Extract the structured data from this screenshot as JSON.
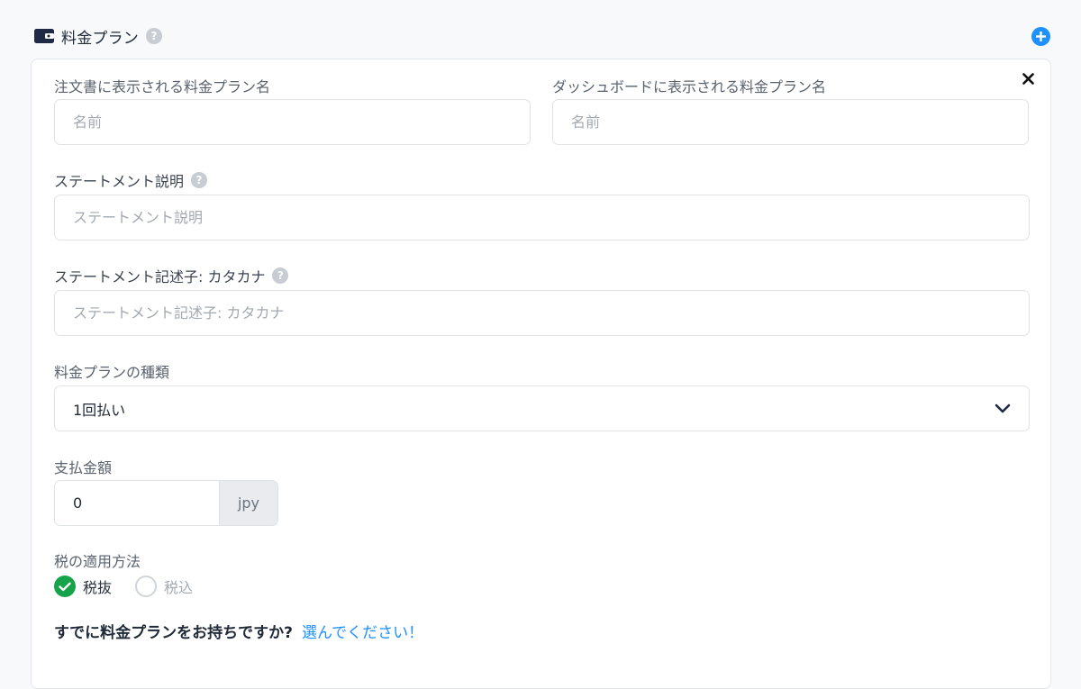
{
  "section": {
    "title": "料金プラン",
    "help": "?"
  },
  "form": {
    "order_name": {
      "label": "注文書に表示される料金プラン名",
      "placeholder": "名前"
    },
    "dashboard_name": {
      "label": "ダッシュボードに表示される料金プラン名",
      "placeholder": "名前"
    },
    "statement_desc": {
      "label": "ステートメント説明",
      "placeholder": "ステートメント説明"
    },
    "statement_kana": {
      "label": "ステートメント記述子: カタカナ",
      "placeholder": "ステートメント記述子: カタカナ"
    },
    "plan_type": {
      "label": "料金プランの種類",
      "value": "1回払い"
    },
    "amount": {
      "label": "支払金額",
      "value": "0",
      "currency": "jpy"
    },
    "tax": {
      "label": "税の適用方法",
      "options": [
        {
          "label": "税抜",
          "selected": true
        },
        {
          "label": "税込",
          "selected": false
        }
      ]
    }
  },
  "footer": {
    "question": "すでに料金プランをお持ちですか?",
    "link": "選んでください！"
  },
  "colors": {
    "accent": "#1e90ff",
    "success": "#17a34a"
  }
}
